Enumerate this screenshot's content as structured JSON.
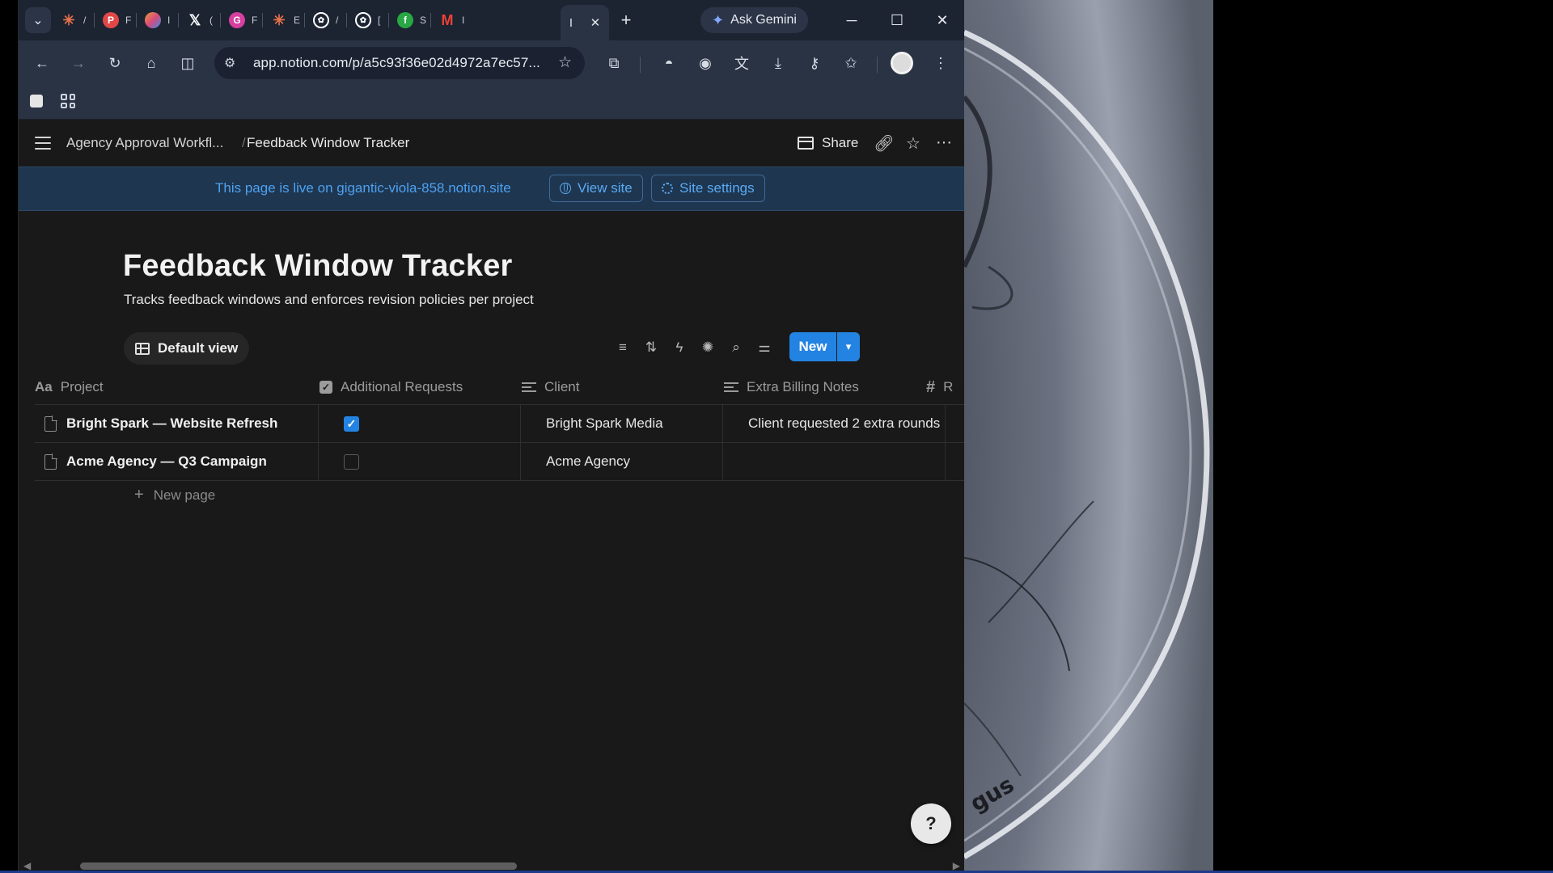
{
  "browser": {
    "tabs": [
      {
        "icon": "asterisk-favicon-icon",
        "label": "/",
        "color": "#e8744a"
      },
      {
        "icon": "p-favicon-icon",
        "label": "F",
        "color": "#e04848"
      },
      {
        "icon": "multicolor-favicon-icon",
        "label": "I",
        "color": "#e6a03a"
      },
      {
        "icon": "x-favicon-icon",
        "label": "(",
        "color": "#ffffff"
      },
      {
        "icon": "g-favicon-icon",
        "label": "F",
        "color": "#d63fa0"
      },
      {
        "icon": "asterisk-favicon-icon",
        "label": "E",
        "color": "#e8744a"
      },
      {
        "icon": "openai-favicon-icon",
        "label": "/",
        "color": "#ffffff"
      },
      {
        "icon": "openai-favicon-icon",
        "label": "[",
        "color": "#ffffff"
      },
      {
        "icon": "fn-favicon-icon",
        "label": "S",
        "color": "#28a745"
      },
      {
        "icon": "gmail-favicon-icon",
        "label": "I",
        "color": "#ea4335"
      }
    ],
    "active_tab": {
      "label": "I",
      "close": "✕"
    },
    "new_tab": "+",
    "gemini_label": "Ask Gemini",
    "url": "app.notion.com/p/a5c93f36e02d4972a7ec57..."
  },
  "notion": {
    "breadcrumb": {
      "parent": "Agency Approval Workfl...",
      "separator": "/",
      "current": "Feedback Window Tracker"
    },
    "share_label": "Share",
    "banner": {
      "text": "This page is live on gigantic-viola-858.notion.site",
      "view_site": "View site",
      "site_settings": "Site settings"
    },
    "page_title": "Feedback Window Tracker",
    "page_description": "Tracks feedback windows and enforces revision policies per project",
    "view_tab": "Default view",
    "new_button": "New",
    "columns": {
      "project": {
        "icon": "Aa",
        "label": "Project"
      },
      "additional": {
        "label": "Additional Requests"
      },
      "client": {
        "label": "Client"
      },
      "notes": {
        "label": "Extra Billing Notes"
      },
      "next": {
        "icon": "#",
        "label": "R"
      }
    },
    "rows": [
      {
        "project": "Bright Spark — Website Refresh",
        "additional_requests": true,
        "client": "Bright Spark Media",
        "notes": "Client requested 2 extra rounds"
      },
      {
        "project": "Acme Agency — Q3 Campaign",
        "additional_requests": false,
        "client": "Acme Agency",
        "notes": ""
      }
    ],
    "new_page": "New page",
    "accent": "#2383e2"
  },
  "wallpaper": {
    "watermark": "gus"
  }
}
